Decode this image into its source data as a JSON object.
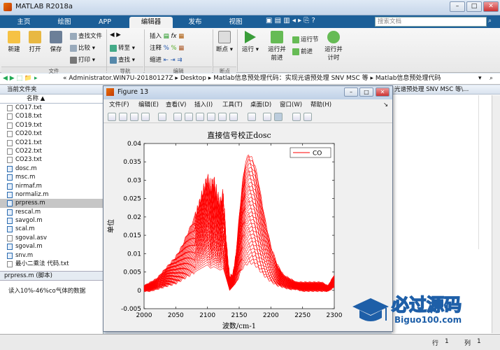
{
  "window": {
    "title": "MATLAB R2018a"
  },
  "tabs": [
    "主页",
    "绘图",
    "APP",
    "编辑器",
    "发布",
    "视图"
  ],
  "search": {
    "placeholder": "搜索文档"
  },
  "ribbon": {
    "file": {
      "new": "新建",
      "open": "打开",
      "save": "保存",
      "find_files": "查找文件",
      "compare": "比较",
      "print": "打印",
      "group": "文件"
    },
    "nav": {
      "goto": "转至",
      "find": "查找",
      "group": "导航"
    },
    "edit": {
      "insert": "插入",
      "comment": "注释",
      "indent": "缩进",
      "group": "编辑"
    },
    "breakpoints": {
      "label": "断点",
      "group": "断点"
    },
    "run": {
      "run": "运行",
      "run_advance": "运行并\n前进",
      "run_section": "运行节",
      "advance": "前进",
      "run_time": "运行并\n计时"
    }
  },
  "address": {
    "path": "« Administrator.WIN7U-20180127Z ▸ Desktop ▸ Matlab信息预处理代码：实现光谱预处理 SNV MSC 等 ▸ Matlab信息预处理代码",
    "right_header": "光谱预处理 SNV MSC 等\\..."
  },
  "folder": {
    "header": "当前文件夹",
    "col_name": "名称 ▲",
    "files": [
      {
        "name": "CO17.txt",
        "type": "txt"
      },
      {
        "name": "CO18.txt",
        "type": "txt"
      },
      {
        "name": "CO19.txt",
        "type": "txt"
      },
      {
        "name": "CO20.txt",
        "type": "txt"
      },
      {
        "name": "CO21.txt",
        "type": "txt"
      },
      {
        "name": "CO22.txt",
        "type": "txt"
      },
      {
        "name": "CO23.txt",
        "type": "txt"
      },
      {
        "name": "dosc.m",
        "type": "m"
      },
      {
        "name": "msc.m",
        "type": "m"
      },
      {
        "name": "nirmaf.m",
        "type": "m"
      },
      {
        "name": "normaliz.m",
        "type": "m"
      },
      {
        "name": "prpress.m",
        "type": "m",
        "selected": true
      },
      {
        "name": "rescal.m",
        "type": "m"
      },
      {
        "name": "savgol.m",
        "type": "m"
      },
      {
        "name": "scal.m",
        "type": "m"
      },
      {
        "name": "sgoval.asv",
        "type": "txt"
      },
      {
        "name": "sgoval.m",
        "type": "m"
      },
      {
        "name": "snv.m",
        "type": "m"
      },
      {
        "name": "最小二乘法 代码.txt",
        "type": "txt"
      }
    ],
    "details_title": "prpress.m (脚本)",
    "details_text": "读入10%-46%co气体的数据"
  },
  "status": {
    "row_label": "行",
    "row": "1",
    "col_label": "列",
    "col": "1"
  },
  "figure": {
    "title": "Figure 13",
    "menu": [
      "文件(F)",
      "编辑(E)",
      "查看(V)",
      "插入(I)",
      "工具(T)",
      "桌面(D)",
      "窗口(W)",
      "帮助(H)"
    ]
  },
  "watermark": {
    "cn": "必过源码",
    "en": "Biguo100.com"
  },
  "colors": {
    "line": "#ff0000",
    "tabbar": "#1c5f98"
  },
  "chart_data": {
    "type": "line",
    "title": "直接信号校正dosc",
    "xlabel": "波数/cm-1",
    "ylabel": "单位",
    "xlim": [
      2000,
      2300
    ],
    "ylim": [
      -0.005,
      0.04
    ],
    "xticks": [
      2000,
      2050,
      2100,
      2150,
      2200,
      2250,
      2300
    ],
    "yticks": [
      -0.005,
      0,
      0.005,
      0.01,
      0.015,
      0.02,
      0.025,
      0.03,
      0.035,
      0.04
    ],
    "ytick_labels": [
      "-0.005",
      "0",
      "0.005",
      "0.01",
      "0.015",
      "0.02",
      "0.025",
      "0.03",
      "0.035",
      "0.04"
    ],
    "legend": {
      "entries": [
        "CO"
      ],
      "position": "top-right"
    },
    "grid": false,
    "series_count": 37,
    "envelope": {
      "x": [
        2000,
        2010,
        2020,
        2030,
        2040,
        2050,
        2060,
        2070,
        2080,
        2090,
        2100,
        2105,
        2110,
        2115,
        2120,
        2125,
        2130,
        2135,
        2140,
        2145,
        2150,
        2155,
        2160,
        2165,
        2170,
        2175,
        2180,
        2185,
        2190,
        2200,
        2210,
        2220,
        2230,
        2240,
        2250,
        2260,
        2270,
        2280,
        2290,
        2300
      ],
      "max": [
        0.001,
        0.002,
        0.003,
        0.005,
        0.007,
        0.009,
        0.012,
        0.016,
        0.02,
        0.025,
        0.03,
        0.027,
        0.029,
        0.025,
        0.023,
        0.026,
        0.012,
        0.003,
        0.004,
        0.01,
        0.02,
        0.029,
        0.035,
        0.037,
        0.036,
        0.034,
        0.03,
        0.025,
        0.02,
        0.012,
        0.007,
        0.004,
        0.003,
        0.002,
        0.002,
        0.002,
        0.002,
        0.002,
        0.001,
        0.004
      ],
      "min": [
        0,
        0,
        0.0005,
        0.001,
        0.0015,
        0.002,
        0.003,
        0.004,
        0.005,
        0.006,
        0.007,
        0.006,
        0.0065,
        0.006,
        0.0055,
        0.006,
        0.003,
        0,
        0.001,
        0.002,
        0.004,
        0.006,
        0.007,
        0.0075,
        0.0075,
        0.007,
        0.006,
        0.005,
        0.004,
        0.0025,
        0.0015,
        0.001,
        0.0005,
        0.0005,
        0,
        0,
        0,
        0,
        0,
        0.001
      ]
    }
  }
}
